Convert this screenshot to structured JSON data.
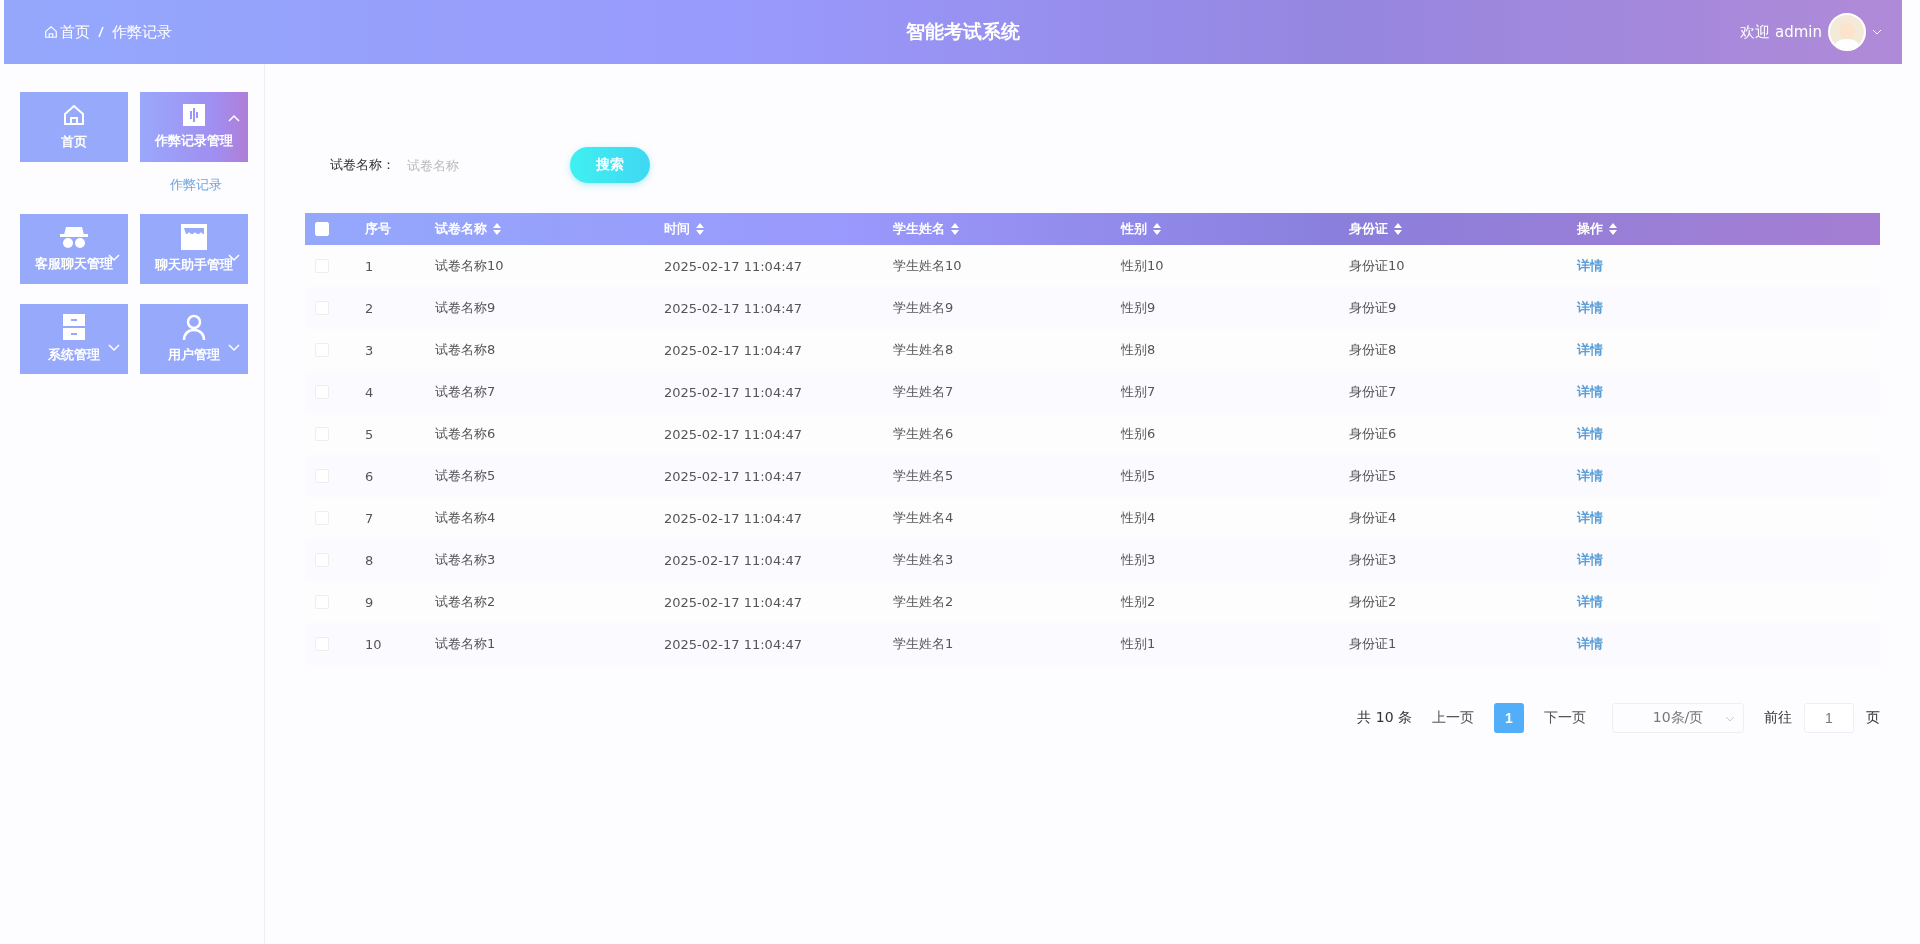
{
  "header": {
    "breadcrumb": [
      "首页",
      "作弊记录"
    ],
    "title": "智能考试系统",
    "user": "欢迎 admin"
  },
  "menu": [
    {
      "label": "首页",
      "kind": "home",
      "selected": false
    },
    {
      "label": "作弊记录管理",
      "kind": "chart",
      "selected": true,
      "expanded": true,
      "children": [
        {
          "label": "作弊记录"
        }
      ]
    },
    {
      "label": "客服聊天管理",
      "kind": "spy",
      "selected": false,
      "expanded": false
    },
    {
      "label": "聊天助手管理",
      "kind": "shop",
      "selected": false,
      "expanded": false
    },
    {
      "label": "系统管理",
      "kind": "cabinet",
      "selected": false,
      "expanded": false
    },
    {
      "label": "用户管理",
      "kind": "user",
      "selected": false,
      "expanded": false
    }
  ],
  "search": {
    "label": "试卷名称：",
    "placeholder": "试卷名称",
    "button": "搜索"
  },
  "table": {
    "select_all_checked": false,
    "columns": [
      "序号",
      "试卷名称",
      "时间",
      "学生姓名",
      "性别",
      "身份证",
      "操作"
    ],
    "rows": [
      {
        "checked": false,
        "cells": [
          "1",
          "试卷名称10",
          "2025-02-17 11:04:47",
          "学生姓名10",
          "性别10",
          "身份证10"
        ],
        "action": "详情"
      },
      {
        "checked": false,
        "cells": [
          "2",
          "试卷名称9",
          "2025-02-17 11:04:47",
          "学生姓名9",
          "性别9",
          "身份证9"
        ],
        "action": "详情"
      },
      {
        "checked": false,
        "cells": [
          "3",
          "试卷名称8",
          "2025-02-17 11:04:47",
          "学生姓名8",
          "性别8",
          "身份证8"
        ],
        "action": "详情"
      },
      {
        "checked": false,
        "cells": [
          "4",
          "试卷名称7",
          "2025-02-17 11:04:47",
          "学生姓名7",
          "性别7",
          "身份证7"
        ],
        "action": "详情"
      },
      {
        "checked": false,
        "cells": [
          "5",
          "试卷名称6",
          "2025-02-17 11:04:47",
          "学生姓名6",
          "性别6",
          "身份证6"
        ],
        "action": "详情"
      },
      {
        "checked": false,
        "cells": [
          "6",
          "试卷名称5",
          "2025-02-17 11:04:47",
          "学生姓名5",
          "性别5",
          "身份证5"
        ],
        "action": "详情"
      },
      {
        "checked": false,
        "cells": [
          "7",
          "试卷名称4",
          "2025-02-17 11:04:47",
          "学生姓名4",
          "性别4",
          "身份证4"
        ],
        "action": "详情"
      },
      {
        "checked": false,
        "cells": [
          "8",
          "试卷名称3",
          "2025-02-17 11:04:47",
          "学生姓名3",
          "性别3",
          "身份证3"
        ],
        "action": "详情"
      },
      {
        "checked": false,
        "cells": [
          "9",
          "试卷名称2",
          "2025-02-17 11:04:47",
          "学生姓名2",
          "性别2",
          "身份证2"
        ],
        "action": "详情"
      },
      {
        "checked": false,
        "cells": [
          "10",
          "试卷名称1",
          "2025-02-17 11:04:47",
          "学生姓名1",
          "性别1",
          "身份证1"
        ],
        "action": "详情"
      }
    ]
  },
  "pagination": {
    "total": "共 10 条",
    "prev": "上一页",
    "pages": [
      {
        "label": "1",
        "selected": true
      }
    ],
    "next": "下一页",
    "page_size": "10条/页",
    "goto_label": "前往",
    "goto_value": "1",
    "goto_suffix": "页"
  }
}
